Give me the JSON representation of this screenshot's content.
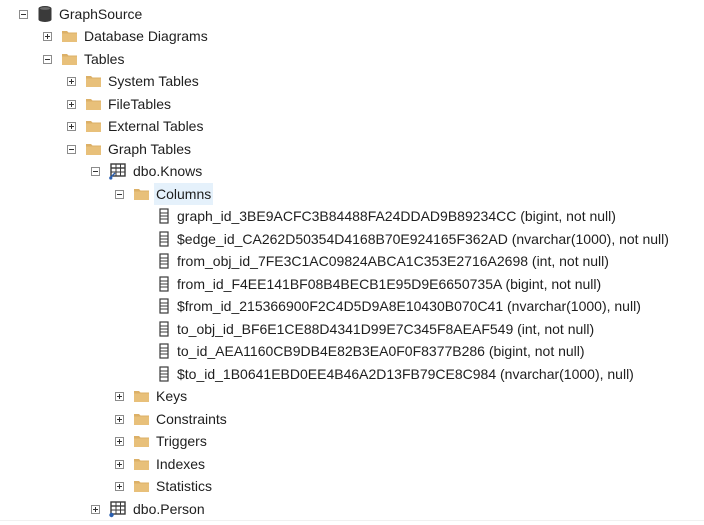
{
  "tree": {
    "database": {
      "label": "GraphSource",
      "icon": "database-icon"
    },
    "database_diagrams": {
      "label": "Database Diagrams",
      "icon": "folder-icon"
    },
    "tables": {
      "label": "Tables",
      "icon": "folder-icon"
    },
    "system_tables": {
      "label": "System Tables",
      "icon": "folder-icon"
    },
    "file_tables": {
      "label": "FileTables",
      "icon": "folder-icon"
    },
    "external_tables": {
      "label": "External Tables",
      "icon": "folder-icon"
    },
    "graph_tables": {
      "label": "Graph Tables",
      "icon": "folder-icon"
    },
    "knows_table": {
      "label": "dbo.Knows",
      "icon": "edge-table-icon"
    },
    "columns_folder": {
      "label": "Columns",
      "icon": "folder-icon"
    },
    "columns": [
      {
        "label": "graph_id_3BE9ACFC3B84488FA24DDAD9B89234CC (bigint, not null)",
        "icon": "column-icon"
      },
      {
        "label": "$edge_id_CA262D50354D4168B70E924165F362AD (nvarchar(1000), not null)",
        "icon": "column-icon"
      },
      {
        "label": "from_obj_id_7FE3C1AC09824ABCA1C353E2716A2698 (int, not null)",
        "icon": "column-icon"
      },
      {
        "label": "from_id_F4EE141BF08B4BECB1E95D9E6650735A (bigint, not null)",
        "icon": "column-icon"
      },
      {
        "label": "$from_id_215366900F2C4D5D9A8E10430B070C41 (nvarchar(1000), null)",
        "icon": "column-icon"
      },
      {
        "label": "to_obj_id_BF6E1CE88D4341D99E7C345F8AEAF549 (int, not null)",
        "icon": "column-icon"
      },
      {
        "label": "to_id_AEA1160CB9DB4E82B3EA0F0F8377B286 (bigint, not null)",
        "icon": "column-icon"
      },
      {
        "label": "$to_id_1B0641EBD0EE4B46A2D13FB79CE8C984 (nvarchar(1000), null)",
        "icon": "column-icon"
      }
    ],
    "keys": {
      "label": "Keys",
      "icon": "folder-icon"
    },
    "constraints": {
      "label": "Constraints",
      "icon": "folder-icon"
    },
    "triggers": {
      "label": "Triggers",
      "icon": "folder-icon"
    },
    "indexes": {
      "label": "Indexes",
      "icon": "folder-icon"
    },
    "statistics": {
      "label": "Statistics",
      "icon": "folder-icon"
    },
    "person_table": {
      "label": "dbo.Person",
      "icon": "node-table-icon"
    }
  },
  "colors": {
    "folder": "#dcb067",
    "folder_dark": "#c99a45",
    "selection": "#e5f1fb",
    "text": "#1e1e1e"
  }
}
